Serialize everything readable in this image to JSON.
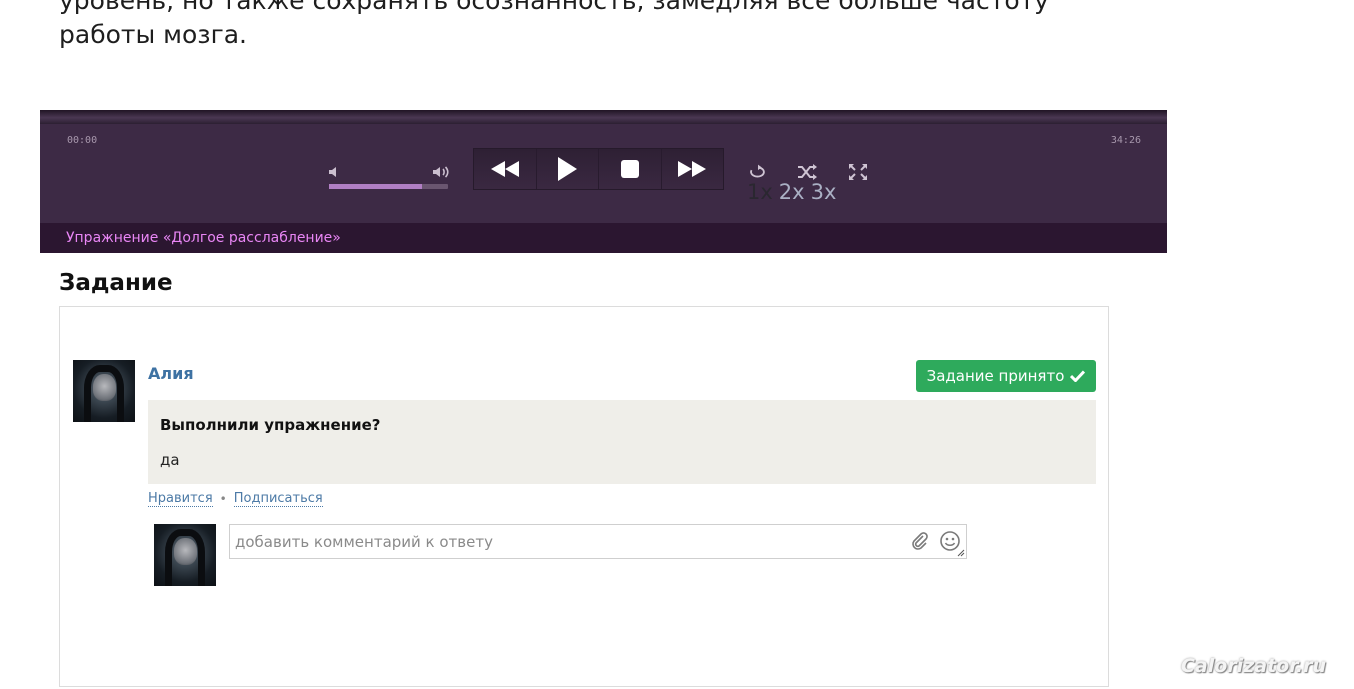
{
  "intro": {
    "line1": "уровень, но также сохранять осознанность, замедляя все больше частоту",
    "line2": "работы мозга."
  },
  "player": {
    "time_start": "00:00",
    "time_end": "34:26",
    "volume_level": 0.78,
    "speeds": [
      "1x",
      "2x",
      "3x"
    ],
    "active_speed": "1x",
    "caption": "Упражнение «Долгое расслабление»",
    "icons": [
      "volume-low-icon",
      "volume-high-icon",
      "rewind-icon",
      "play-icon",
      "stop-icon",
      "fast-forward-icon",
      "repeat-icon",
      "shuffle-icon",
      "fullscreen-icon"
    ]
  },
  "task": {
    "title": "Задание",
    "author": "Алия",
    "status_label": "Задание принято",
    "status_color": "#2eaa5c",
    "question": "Выполнили упражнение?",
    "answer": "да",
    "like_label": "Нравится",
    "separator": "•",
    "subscribe_label": "Подписаться",
    "comment_placeholder": "добавить комментарий к ответу"
  },
  "watermark": "Calorizator.ru"
}
